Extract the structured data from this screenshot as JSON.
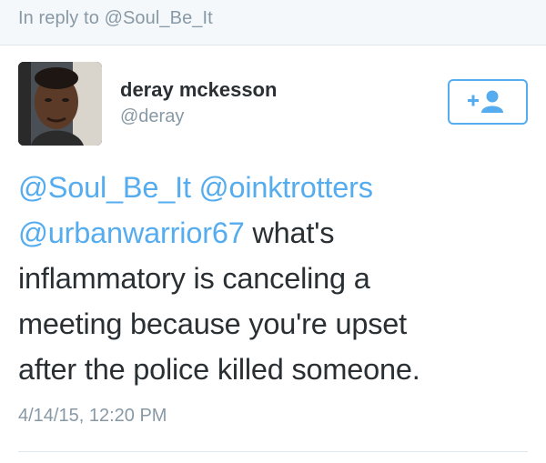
{
  "reply_context": {
    "text": "In reply to @Soul_Be_It"
  },
  "user": {
    "display_name": "deray mckesson",
    "handle": "@deray",
    "avatar_icon": "profile-photo"
  },
  "follow_button": {
    "icon": "follow-user-icon",
    "color": "#55acee"
  },
  "tweet": {
    "mention_1": "@Soul_Be_It",
    "mention_2": "@oinktrotters",
    "mention_3": "@urbanwarrior67",
    "line2_rest": " what's",
    "line3": "inflammatory is canceling a",
    "line4": "meeting because you're upset",
    "line5": "after the police killed someone.",
    "timestamp": "4/14/15, 12:20 PM"
  },
  "colors": {
    "link": "#55acee",
    "text": "#292f33",
    "muted": "#8899a6"
  }
}
